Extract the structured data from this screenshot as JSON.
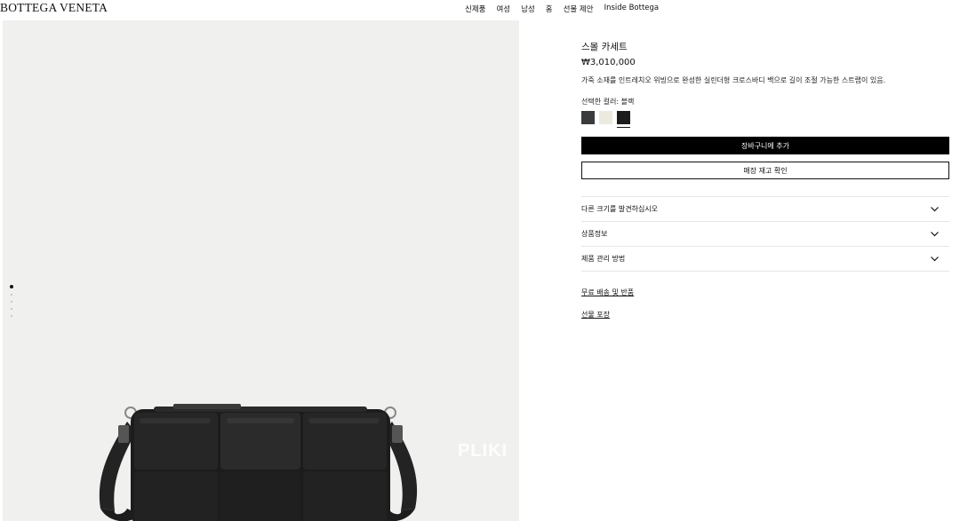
{
  "header": {
    "logo": "BOTTEGA VENETA",
    "nav": [
      "신제품",
      "여성",
      "남성",
      "홈",
      "선물 제안",
      "Inside Bottega"
    ]
  },
  "gallery": {
    "watermark": "PLIKI",
    "image_count": 5,
    "active_index": 0,
    "bg_color": "#f0f1ef"
  },
  "product": {
    "name": "스몰 카세트",
    "price": "₩3,010,000",
    "description": "가죽 소재를 인트레치오 위빙으로 완성한 실린더형 크로스바디 백으로 길이 조절 가능한 스트랩이 있음.",
    "color_label": "선택한 컬러: 블랙",
    "swatches": [
      {
        "name": "dark-grey",
        "color": "#3a3b3c",
        "selected": false
      },
      {
        "name": "cream",
        "color": "#ece9df",
        "selected": false
      },
      {
        "name": "black",
        "color": "#1c1c1c",
        "selected": true
      }
    ],
    "add_to_cart": "장바구니에 추가",
    "check_stock": "매장 재고 확인",
    "accordion": [
      "다른 크기를 발견하십시오",
      "상품정보",
      "제품 관리 방법"
    ],
    "links": [
      "무료 배송 및 반품",
      "선물 포장"
    ]
  }
}
